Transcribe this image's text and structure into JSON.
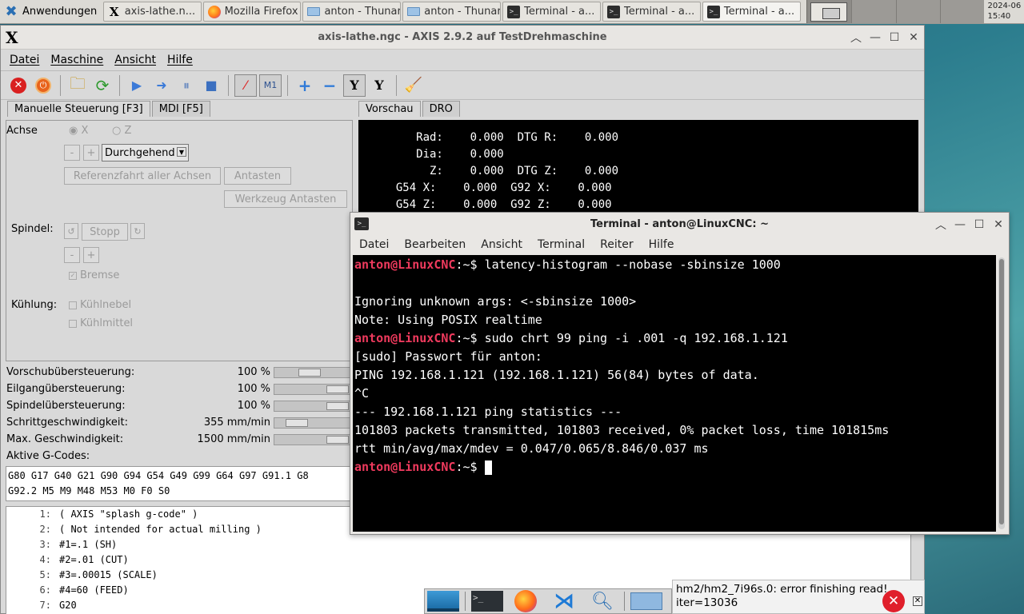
{
  "panel": {
    "apps_label": "Anwendungen",
    "tasks": [
      {
        "label": "axis-lathe.n...",
        "icon": "x-icon"
      },
      {
        "label": "Mozilla Firefox",
        "icon": "firefox-icon"
      },
      {
        "label": "anton - Thunar",
        "icon": "folder-icon"
      },
      {
        "label": "anton - Thunar",
        "icon": "folder-icon"
      },
      {
        "label": "Terminal - a...",
        "icon": "terminal-icon"
      },
      {
        "label": "Terminal - a...",
        "icon": "terminal-icon"
      },
      {
        "label": "Terminal - a...",
        "icon": "terminal-icon"
      }
    ],
    "clock_date": "2024-06",
    "clock_time": "15:40"
  },
  "axis": {
    "title": "axis-lathe.ngc - AXIS 2.9.2 auf TestDrehmaschine",
    "menu": [
      "Datei",
      "Maschine",
      "Ansicht",
      "Hilfe"
    ],
    "tabs": {
      "manual": "Manuelle Steuerung [F3]",
      "mdi": "MDI [F5]",
      "preview": "Vorschau",
      "dro": "DRO"
    },
    "manual": {
      "axis_label": "Achse",
      "axis_x": "X",
      "axis_z": "Z",
      "minus": "-",
      "plus": "+",
      "jog_mode": "Durchgehend",
      "home_all": "Referenzfahrt aller Achsen",
      "touch_off": "Antasten",
      "tool_touch_off": "Werkzeug Antasten",
      "spindle_label": "Spindel:",
      "spindle_stop": "Stopp",
      "brake": "Bremse",
      "coolant_label": "Kühlung:",
      "mist": "Kühlnebel",
      "flood": "Kühlmittel"
    },
    "sliders": [
      {
        "name": "Vorschubübersteuerung:",
        "value": "100 %",
        "position": 0.45
      },
      {
        "name": "Eilgangübersteuerung:",
        "value": "100 %",
        "position": 1.0
      },
      {
        "name": "Spindelübersteuerung:",
        "value": "100 %",
        "position": 1.0
      },
      {
        "name": "Schrittgeschwindigkeit:",
        "value": "355 mm/min",
        "position": 0.2
      },
      {
        "name": "Max. Geschwindigkeit:",
        "value": "1500 mm/min",
        "position": 1.0
      }
    ],
    "gcodes_label": "Aktive G-Codes:",
    "gcodes_text": "G80 G17 G40 G21 G90 G94 G54 G49 G99 G64 G97 G91.1 G8\nG92.2 M5 M9 M48 M53 M0 F0 S0",
    "program": [
      {
        "n": "1:",
        "code": "( AXIS \"splash g-code\" )"
      },
      {
        "n": "2:",
        "code": "( Not intended for actual milling )"
      },
      {
        "n": "3:",
        "code": "#1=.1 (SH)"
      },
      {
        "n": "4:",
        "code": "#2=.01 (CUT)"
      },
      {
        "n": "5:",
        "code": "#3=.00015 (SCALE)"
      },
      {
        "n": "6:",
        "code": "#4=60 (FEED)"
      },
      {
        "n": "7:",
        "code": "G20"
      }
    ],
    "dro": [
      "     Rad:    0.000  DTG R:    0.000",
      "     Dia:    0.000",
      "       Z:    0.000  DTG Z:    0.000",
      "  G54 X:    0.000  G92 X:    0.000",
      "  G54 Z:    0.000  G92 Z:    0.000"
    ]
  },
  "terminal": {
    "title": "Terminal - anton@LinuxCNC: ~",
    "menu": [
      "Datei",
      "Bearbeiten",
      "Ansicht",
      "Terminal",
      "Reiter",
      "Hilfe"
    ],
    "prompt": "anton@LinuxCNC",
    "prompt_suffix": ":~$ ",
    "cmd1": "latency-histogram --nobase -sbinsize 1000",
    "out1": "Ignoring unknown args: <-sbinsize 1000>",
    "out2": "Note: Using POSIX realtime",
    "cmd2": "sudo chrt 99 ping -i .001 -q 192.168.1.121",
    "out3": "[sudo] Passwort für anton:",
    "out4": "PING 192.168.1.121 (192.168.1.121) 56(84) bytes of data.",
    "out5": "^C",
    "out6": "--- 192.168.1.121 ping statistics ---",
    "out7": "101803 packets transmitted, 101803 received, 0% packet loss, time 101815ms",
    "out8": "rtt min/avg/max/mdev = 0.047/0.065/8.846/0.037 ms"
  },
  "notification": {
    "line1": "hm2/hm2_7i96s.0: error finishing read!",
    "line2": "iter=13036"
  },
  "colors": {
    "prompt": "#ef3a5d",
    "terminal_bg": "#000000",
    "estop": "#d92020"
  }
}
